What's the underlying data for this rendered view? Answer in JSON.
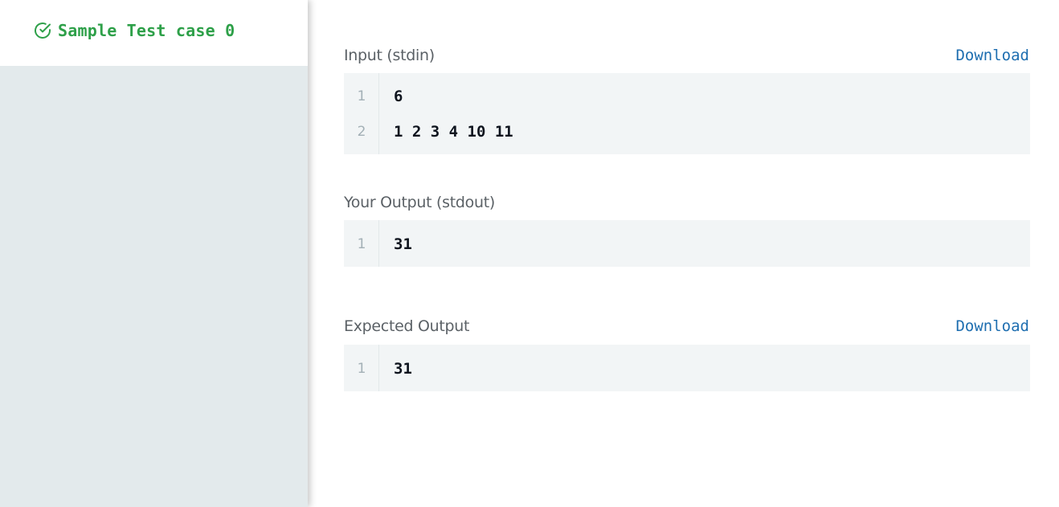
{
  "sidebar": {
    "active_tab": {
      "label": "Sample Test case 0",
      "icon": "check-circle-icon",
      "color": "#2ea049"
    }
  },
  "sections": {
    "input": {
      "label": "Input (stdin)",
      "download_label": "Download",
      "lines": [
        {
          "num": "1",
          "text": "6"
        },
        {
          "num": "2",
          "text": "1 2 3 4 10 11"
        }
      ]
    },
    "your_output": {
      "label": "Your Output (stdout)",
      "lines": [
        {
          "num": "1",
          "text": "31"
        }
      ]
    },
    "expected_output": {
      "label": "Expected Output",
      "download_label": "Download",
      "lines": [
        {
          "num": "1",
          "text": "31"
        }
      ]
    }
  },
  "colors": {
    "success": "#2ea049",
    "link": "#1e6eb0",
    "sidebar_bg": "#e3eaec",
    "code_bg": "#f2f5f6"
  }
}
